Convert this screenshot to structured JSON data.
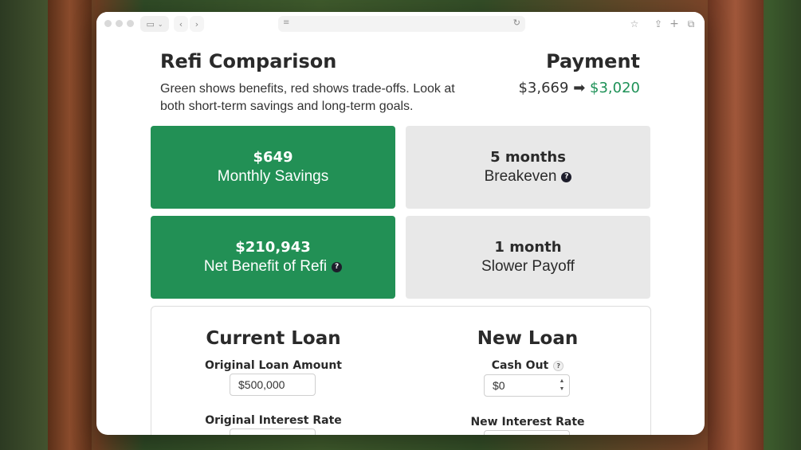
{
  "browser": {
    "window_controls": [
      "close",
      "minimize",
      "zoom"
    ],
    "icons": [
      "sidebar-icon",
      "chevron-down-icon",
      "back-icon",
      "forward-icon",
      "site-settings-icon",
      "reload-icon",
      "star-icon",
      "share-icon",
      "new-tab-icon",
      "tabs-overview-icon"
    ]
  },
  "header": {
    "title": "Refi Comparison",
    "subtitle": "Green shows benefits, red shows trade-offs. Look at both short-term savings and long-term goals.",
    "payment_label": "Payment",
    "payment_old": "$3,669",
    "payment_arrow": "➡",
    "payment_new": "$3,020"
  },
  "cards": [
    {
      "value": "$649",
      "label": "Monthly Savings",
      "tone": "green",
      "help": false
    },
    {
      "value": "5 months",
      "label": "Breakeven",
      "tone": "gray",
      "help": true
    },
    {
      "value": "$210,943",
      "label": "Net Benefit of Refi",
      "tone": "green",
      "help": true
    },
    {
      "value": "1 month",
      "label": "Slower Payoff",
      "tone": "gray",
      "help": false
    }
  ],
  "help_glyph": "?",
  "current_loan": {
    "title": "Current Loan",
    "fields": [
      {
        "label": "Original Loan Amount",
        "value": "$500,000"
      },
      {
        "label": "Original Interest Rate",
        "value": ""
      }
    ]
  },
  "new_loan": {
    "title": "New Loan",
    "fields": [
      {
        "label": "Cash Out",
        "value": "$0"
      },
      {
        "label": "New Interest Rate",
        "value": ""
      }
    ]
  },
  "colors": {
    "accent_green": "#229055",
    "card_gray": "#e8e8e8",
    "new_payment_green": "#1e9157"
  }
}
